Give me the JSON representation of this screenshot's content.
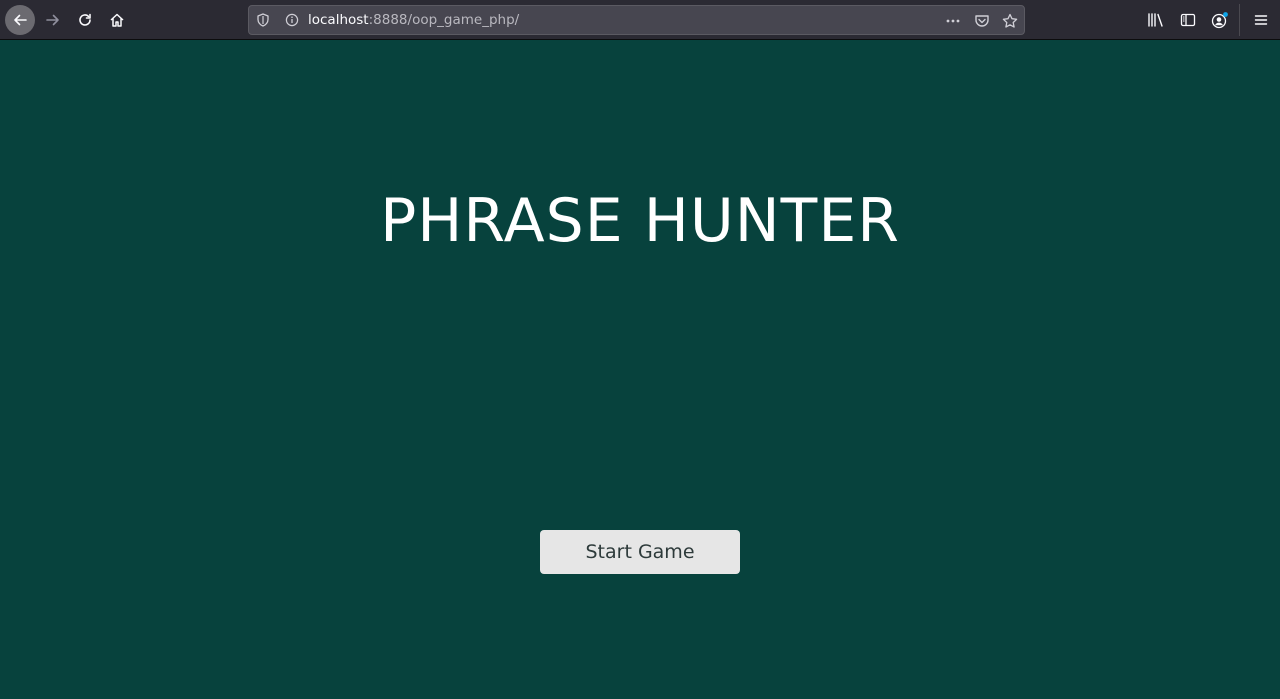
{
  "browser": {
    "url_host": "localhost",
    "url_path": ":8888/oop_game_php/",
    "icons": {
      "back": "back-arrow-icon",
      "forward": "forward-arrow-icon",
      "reload": "reload-icon",
      "home": "home-icon",
      "shield": "shield-icon",
      "info": "info-icon",
      "page_actions": "more-dots-icon",
      "pocket": "pocket-icon",
      "bookmark": "star-icon",
      "library": "library-icon",
      "sidebar": "sidebar-icon",
      "account": "account-icon",
      "menu": "hamburger-menu-icon"
    },
    "colors": {
      "toolbar": "#2b2a33",
      "urlbar": "#474650",
      "notification_dot": "#0ea5e9"
    }
  },
  "page": {
    "title": "PHRASE HUNTER",
    "start_button_label": "Start Game",
    "colors": {
      "background": "#07423d",
      "title_text": "#ffffff",
      "button_bg": "#e6e6e6",
      "button_text": "#2d3a3a"
    }
  }
}
